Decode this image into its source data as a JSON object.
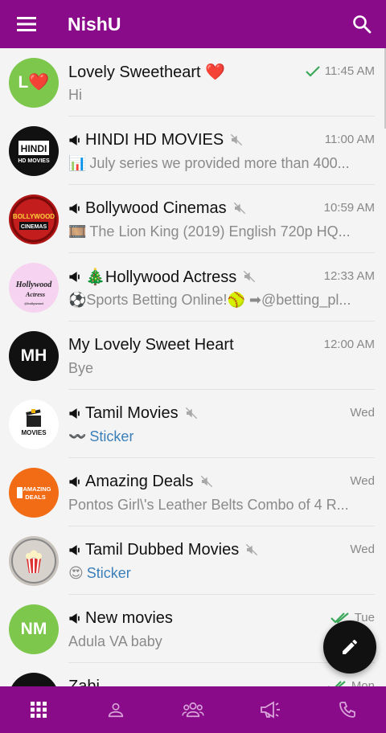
{
  "app_bar": {
    "title": "NishU",
    "menu_icon": "menu-icon",
    "search_icon": "search-icon"
  },
  "chats": [
    {
      "name": "Lovely Sweetheart ❤️",
      "time": "11:45 AM",
      "message": "Hi",
      "status": "read-single",
      "channel": false,
      "muted": false,
      "avatar": {
        "type": "initials",
        "text": "L❤️",
        "color": "#7dc74d"
      }
    },
    {
      "name": "HINDI HD MOVIES",
      "time": "11:00 AM",
      "message": "July series we provided more than 400...",
      "emoji": "📊",
      "channel": true,
      "muted": true,
      "avatar": {
        "type": "logo",
        "text": "HINDI HD MOVIES",
        "color": "#111111"
      }
    },
    {
      "name": "Bollywood Cinemas",
      "time": "10:59 AM",
      "message": "The Lion King (2019) English 720p HQ...",
      "emoji": "🎞️",
      "channel": true,
      "muted": true,
      "avatar": {
        "type": "logo",
        "text": "BOLLYWOOD CINEMAS",
        "color": "#b01515"
      }
    },
    {
      "name": "🎄Hollywood Actress",
      "time": "12:33 AM",
      "message": "⚽Sports Betting Online!🥎 ➡@betting_pl...",
      "channel": true,
      "muted": true,
      "avatar": {
        "type": "logo",
        "text": "Hollywood Actress",
        "color": "#f6d3f0"
      }
    },
    {
      "name": "My Lovely Sweet Heart",
      "time": "12:00 AM",
      "message": "Bye",
      "channel": false,
      "muted": false,
      "avatar": {
        "type": "initials",
        "text": "MH",
        "color": "#111111"
      }
    },
    {
      "name": "Tamil Movies",
      "time": "Wed",
      "message": "Sticker",
      "emoji": "〰️",
      "message_type": "sticker",
      "channel": true,
      "muted": true,
      "avatar": {
        "type": "logo",
        "text": "MOVIES",
        "color": "#ffffff"
      }
    },
    {
      "name": "Amazing Deals",
      "time": "Wed",
      "message": "Pontos Girl\\'s Leather Belts Combo of 4 R...",
      "channel": true,
      "muted": true,
      "avatar": {
        "type": "logo",
        "text": "AMAZING DEALS",
        "color": "#f26c16"
      }
    },
    {
      "name": "Tamil Dubbed Movies",
      "time": "Wed",
      "message": "Sticker",
      "emoji": "😍",
      "message_type": "sticker",
      "channel": true,
      "muted": true,
      "avatar": {
        "type": "logo",
        "text": "popcorn",
        "color": "#c9c3bd"
      }
    },
    {
      "name": "New movies",
      "time": "Tue",
      "message": "Adula VA baby",
      "status": "read-double",
      "channel": true,
      "muted": false,
      "avatar": {
        "type": "initials",
        "text": "NM",
        "color": "#7dc74d"
      }
    },
    {
      "name": "Zabi",
      "time": "Mon",
      "message": "",
      "status": "read-double",
      "channel": false,
      "muted": false,
      "avatar": {
        "type": "initials",
        "text": "",
        "color": "#111111"
      }
    }
  ],
  "fab": {
    "icon": "pencil-icon"
  },
  "bottom_nav": [
    {
      "icon": "grid-icon",
      "active": true
    },
    {
      "icon": "person-icon",
      "active": false
    },
    {
      "icon": "group-icon",
      "active": false
    },
    {
      "icon": "megaphone-icon",
      "active": false
    },
    {
      "icon": "phone-icon",
      "active": false
    }
  ],
  "colors": {
    "brand": "#8a0b8a",
    "check": "#3aa85a",
    "sticker": "#3b7fb9"
  }
}
